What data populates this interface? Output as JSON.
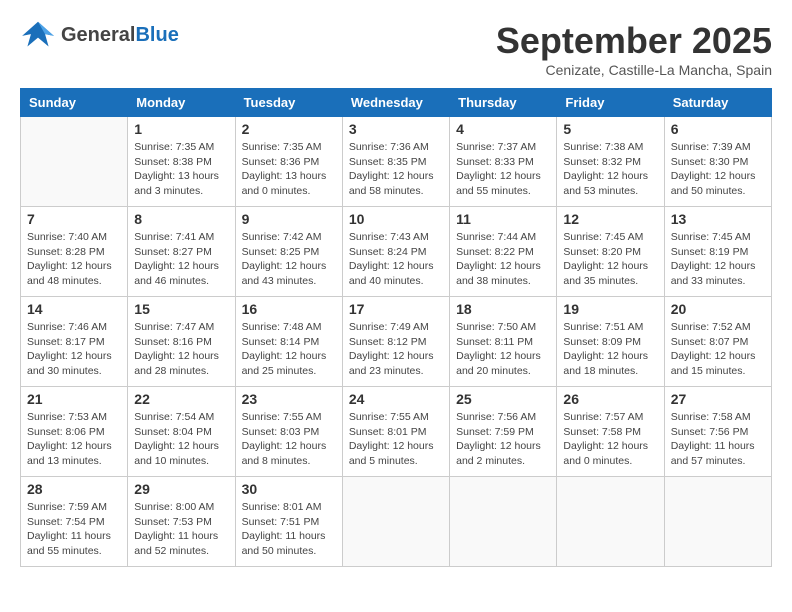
{
  "header": {
    "logo": {
      "general": "General",
      "blue": "Blue"
    },
    "month_title": "September 2025",
    "subtitle": "Cenizate, Castille-La Mancha, Spain"
  },
  "days_of_week": [
    "Sunday",
    "Monday",
    "Tuesday",
    "Wednesday",
    "Thursday",
    "Friday",
    "Saturday"
  ],
  "weeks": [
    [
      {
        "day": "",
        "info": ""
      },
      {
        "day": "1",
        "info": "Sunrise: 7:35 AM\nSunset: 8:38 PM\nDaylight: 13 hours\nand 3 minutes."
      },
      {
        "day": "2",
        "info": "Sunrise: 7:35 AM\nSunset: 8:36 PM\nDaylight: 13 hours\nand 0 minutes."
      },
      {
        "day": "3",
        "info": "Sunrise: 7:36 AM\nSunset: 8:35 PM\nDaylight: 12 hours\nand 58 minutes."
      },
      {
        "day": "4",
        "info": "Sunrise: 7:37 AM\nSunset: 8:33 PM\nDaylight: 12 hours\nand 55 minutes."
      },
      {
        "day": "5",
        "info": "Sunrise: 7:38 AM\nSunset: 8:32 PM\nDaylight: 12 hours\nand 53 minutes."
      },
      {
        "day": "6",
        "info": "Sunrise: 7:39 AM\nSunset: 8:30 PM\nDaylight: 12 hours\nand 50 minutes."
      }
    ],
    [
      {
        "day": "7",
        "info": "Sunrise: 7:40 AM\nSunset: 8:28 PM\nDaylight: 12 hours\nand 48 minutes."
      },
      {
        "day": "8",
        "info": "Sunrise: 7:41 AM\nSunset: 8:27 PM\nDaylight: 12 hours\nand 46 minutes."
      },
      {
        "day": "9",
        "info": "Sunrise: 7:42 AM\nSunset: 8:25 PM\nDaylight: 12 hours\nand 43 minutes."
      },
      {
        "day": "10",
        "info": "Sunrise: 7:43 AM\nSunset: 8:24 PM\nDaylight: 12 hours\nand 40 minutes."
      },
      {
        "day": "11",
        "info": "Sunrise: 7:44 AM\nSunset: 8:22 PM\nDaylight: 12 hours\nand 38 minutes."
      },
      {
        "day": "12",
        "info": "Sunrise: 7:45 AM\nSunset: 8:20 PM\nDaylight: 12 hours\nand 35 minutes."
      },
      {
        "day": "13",
        "info": "Sunrise: 7:45 AM\nSunset: 8:19 PM\nDaylight: 12 hours\nand 33 minutes."
      }
    ],
    [
      {
        "day": "14",
        "info": "Sunrise: 7:46 AM\nSunset: 8:17 PM\nDaylight: 12 hours\nand 30 minutes."
      },
      {
        "day": "15",
        "info": "Sunrise: 7:47 AM\nSunset: 8:16 PM\nDaylight: 12 hours\nand 28 minutes."
      },
      {
        "day": "16",
        "info": "Sunrise: 7:48 AM\nSunset: 8:14 PM\nDaylight: 12 hours\nand 25 minutes."
      },
      {
        "day": "17",
        "info": "Sunrise: 7:49 AM\nSunset: 8:12 PM\nDaylight: 12 hours\nand 23 minutes."
      },
      {
        "day": "18",
        "info": "Sunrise: 7:50 AM\nSunset: 8:11 PM\nDaylight: 12 hours\nand 20 minutes."
      },
      {
        "day": "19",
        "info": "Sunrise: 7:51 AM\nSunset: 8:09 PM\nDaylight: 12 hours\nand 18 minutes."
      },
      {
        "day": "20",
        "info": "Sunrise: 7:52 AM\nSunset: 8:07 PM\nDaylight: 12 hours\nand 15 minutes."
      }
    ],
    [
      {
        "day": "21",
        "info": "Sunrise: 7:53 AM\nSunset: 8:06 PM\nDaylight: 12 hours\nand 13 minutes."
      },
      {
        "day": "22",
        "info": "Sunrise: 7:54 AM\nSunset: 8:04 PM\nDaylight: 12 hours\nand 10 minutes."
      },
      {
        "day": "23",
        "info": "Sunrise: 7:55 AM\nSunset: 8:03 PM\nDaylight: 12 hours\nand 8 minutes."
      },
      {
        "day": "24",
        "info": "Sunrise: 7:55 AM\nSunset: 8:01 PM\nDaylight: 12 hours\nand 5 minutes."
      },
      {
        "day": "25",
        "info": "Sunrise: 7:56 AM\nSunset: 7:59 PM\nDaylight: 12 hours\nand 2 minutes."
      },
      {
        "day": "26",
        "info": "Sunrise: 7:57 AM\nSunset: 7:58 PM\nDaylight: 12 hours\nand 0 minutes."
      },
      {
        "day": "27",
        "info": "Sunrise: 7:58 AM\nSunset: 7:56 PM\nDaylight: 11 hours\nand 57 minutes."
      }
    ],
    [
      {
        "day": "28",
        "info": "Sunrise: 7:59 AM\nSunset: 7:54 PM\nDaylight: 11 hours\nand 55 minutes."
      },
      {
        "day": "29",
        "info": "Sunrise: 8:00 AM\nSunset: 7:53 PM\nDaylight: 11 hours\nand 52 minutes."
      },
      {
        "day": "30",
        "info": "Sunrise: 8:01 AM\nSunset: 7:51 PM\nDaylight: 11 hours\nand 50 minutes."
      },
      {
        "day": "",
        "info": ""
      },
      {
        "day": "",
        "info": ""
      },
      {
        "day": "",
        "info": ""
      },
      {
        "day": "",
        "info": ""
      }
    ]
  ]
}
